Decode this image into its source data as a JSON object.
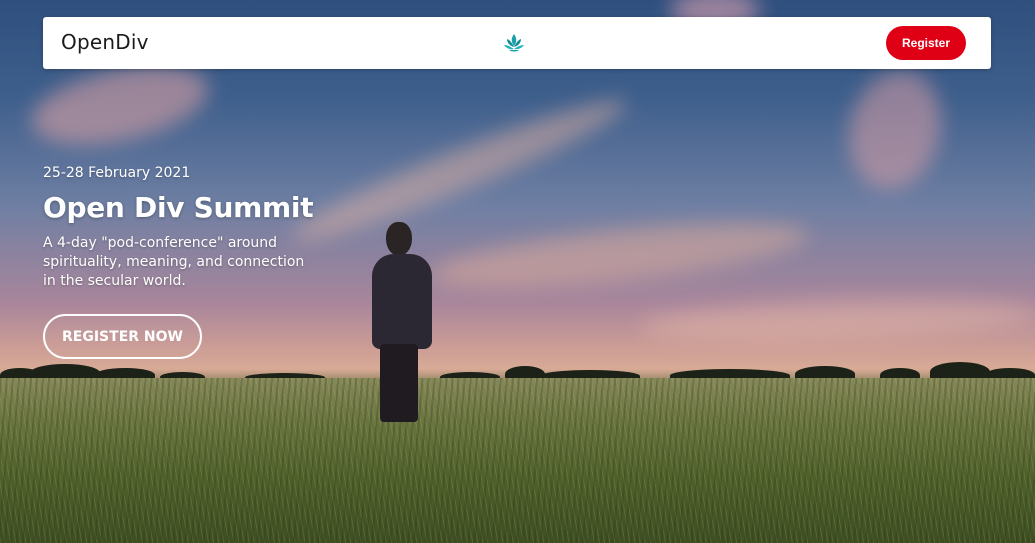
{
  "navbar": {
    "brand": "OpenDiv",
    "logo_icon": "lotus-icon",
    "register_label": "Register",
    "accent_color": "#df0016",
    "logo_color": "#1aa0a8"
  },
  "hero": {
    "dates": "25-28 February 2021",
    "title": "Open Div Summit",
    "subtitle": "A 4-day \"pod-conference\" around spirituality, meaning, and connection in the secular world.",
    "cta_label": "REGISTER NOW"
  }
}
